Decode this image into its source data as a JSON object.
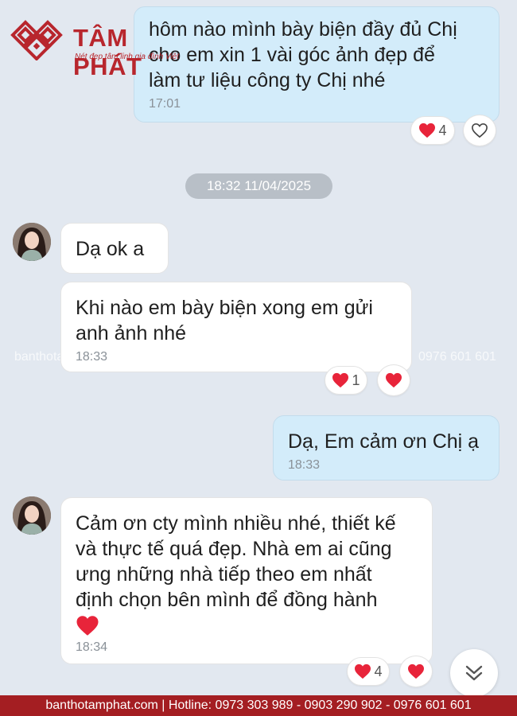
{
  "brand": {
    "name": "TÂM PHÁT",
    "slogan": "Nét đẹp tâm linh gia đình Việt",
    "color": "#b8262d"
  },
  "messages": [
    {
      "id": "m1",
      "direction": "outgoing",
      "text": "hôm nào mình bày biện đầy đủ Chị\ncho em xin 1 vài góc ảnh đẹp để\nlàm tư liệu công ty Chị nhé",
      "time": "17:01",
      "reactions": [
        {
          "icon": "heart-icon",
          "count": "4"
        },
        {
          "icon": "heart-outline-icon",
          "count": ""
        }
      ]
    },
    {
      "id": "m2",
      "direction": "incoming",
      "text": "Dạ ok a",
      "time": ""
    },
    {
      "id": "m3",
      "direction": "incoming",
      "text": "Khi nào em bày biện xong em gửi\nanh ảnh nhé",
      "time": "18:33",
      "reactions": [
        {
          "icon": "heart-icon",
          "count": "1"
        },
        {
          "icon": "heart-icon",
          "count": ""
        }
      ]
    },
    {
      "id": "m4",
      "direction": "outgoing",
      "text": "Dạ, Em cảm ơn Chị ạ",
      "time": "18:33"
    },
    {
      "id": "m5",
      "direction": "incoming",
      "text": "Cảm ơn cty mình nhiều nhé, thiết kế\nvà thực tế quá đẹp. Nhà em ai cũng\nưng những nhà tiếp theo em nhất\nđịnh chọn bên mình để đồng hành",
      "time": "18:34",
      "reactions": [
        {
          "icon": "heart-icon",
          "count": "4"
        },
        {
          "icon": "heart-icon",
          "count": ""
        }
      ]
    }
  ],
  "date_separator": "18:32 11/04/2025",
  "watermark": {
    "left": "banthotamphat.com",
    "right": "0976 601 601"
  },
  "footer": {
    "text": "banthotamphat.com  |  Hotline: 0973 303 989 - 0903 290 902 - 0976 601 601"
  },
  "colors": {
    "background": "#e2e8f0",
    "outgoing_bubble": "#d3ecfa",
    "incoming_bubble": "#ffffff",
    "heart": "#e8243a",
    "footer": "#a41e22"
  }
}
